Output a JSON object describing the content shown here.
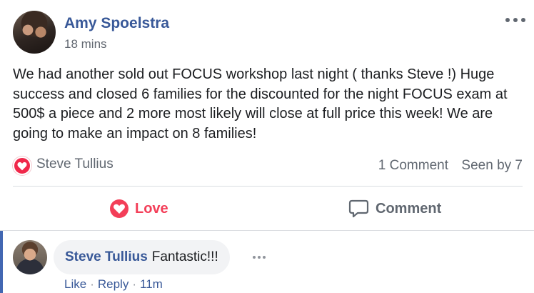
{
  "post": {
    "author": "Amy Spoelstra",
    "timestamp": "18 mins",
    "body": "We had another sold out FOCUS workshop last night ( thanks Steve !) Huge success and closed 6 families for the discounted for the night FOCUS exam at 500$ a piece and 2 more most likely will close at full price this week! We are going to make an impact on 8 families!"
  },
  "reactions": {
    "reactor": "Steve Tullius",
    "comment_count": "1 Comment",
    "seen_by": "Seen by 7"
  },
  "actions": {
    "love_label": "Love",
    "comment_label": "Comment"
  },
  "comment": {
    "author": "Steve Tullius",
    "text": "Fantastic!!!",
    "like_label": "Like",
    "reply_label": "Reply",
    "time": "11m",
    "separator": "·"
  },
  "colors": {
    "author_blue": "#385898",
    "love_red": "#f33e58",
    "muted_gray": "#606770"
  },
  "icons": [
    "more-icon",
    "love-reaction-icon",
    "heart-icon",
    "comment-icon",
    "comment-more-icon"
  ]
}
